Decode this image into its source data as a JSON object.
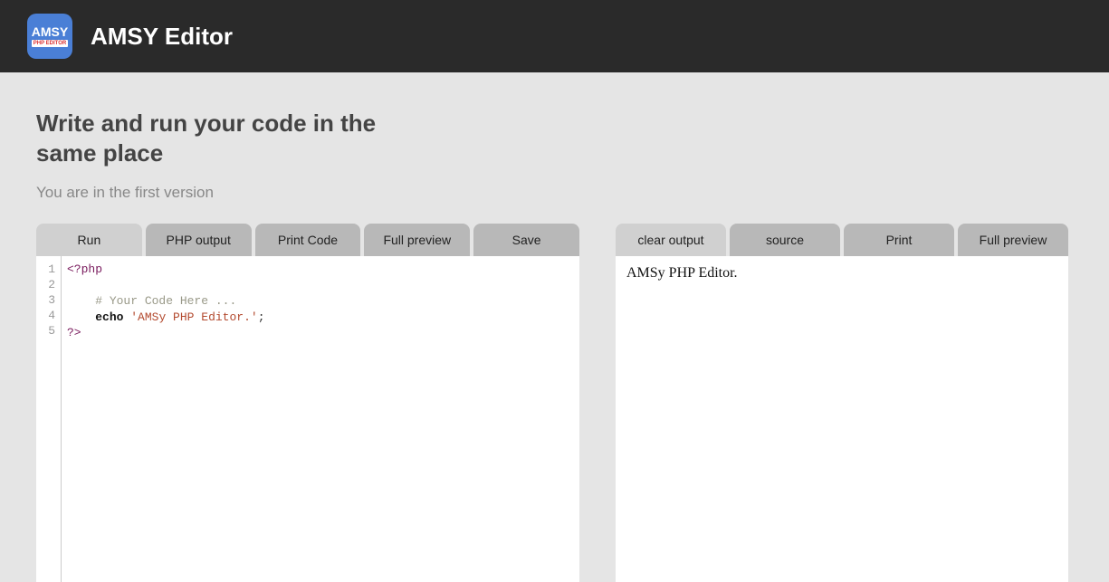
{
  "header": {
    "logo_top": "AMSY",
    "logo_bottom": "PHP EDITOR",
    "title": "AMSY Editor"
  },
  "hero": {
    "headline": "Write and run your code in the same place",
    "subtext": "You are in the first version"
  },
  "editor_tabs": {
    "run": "Run",
    "php_output": "PHP output",
    "print_code": "Print Code",
    "full_preview": "Full preview",
    "save": "Save"
  },
  "output_tabs": {
    "clear_output": "clear output",
    "source": "source",
    "print": "Print",
    "full_preview": "Full preview"
  },
  "code": {
    "line_numbers": [
      "1",
      "2",
      "3",
      "4",
      "5"
    ],
    "l1": "<?php",
    "l3_comment": "# Your Code Here ...",
    "l4_fn": "echo",
    "l4_str": "'AMSy PHP Editor.'",
    "l4_end": ";",
    "l5": "?>"
  },
  "output_text": "AMSy PHP Editor."
}
